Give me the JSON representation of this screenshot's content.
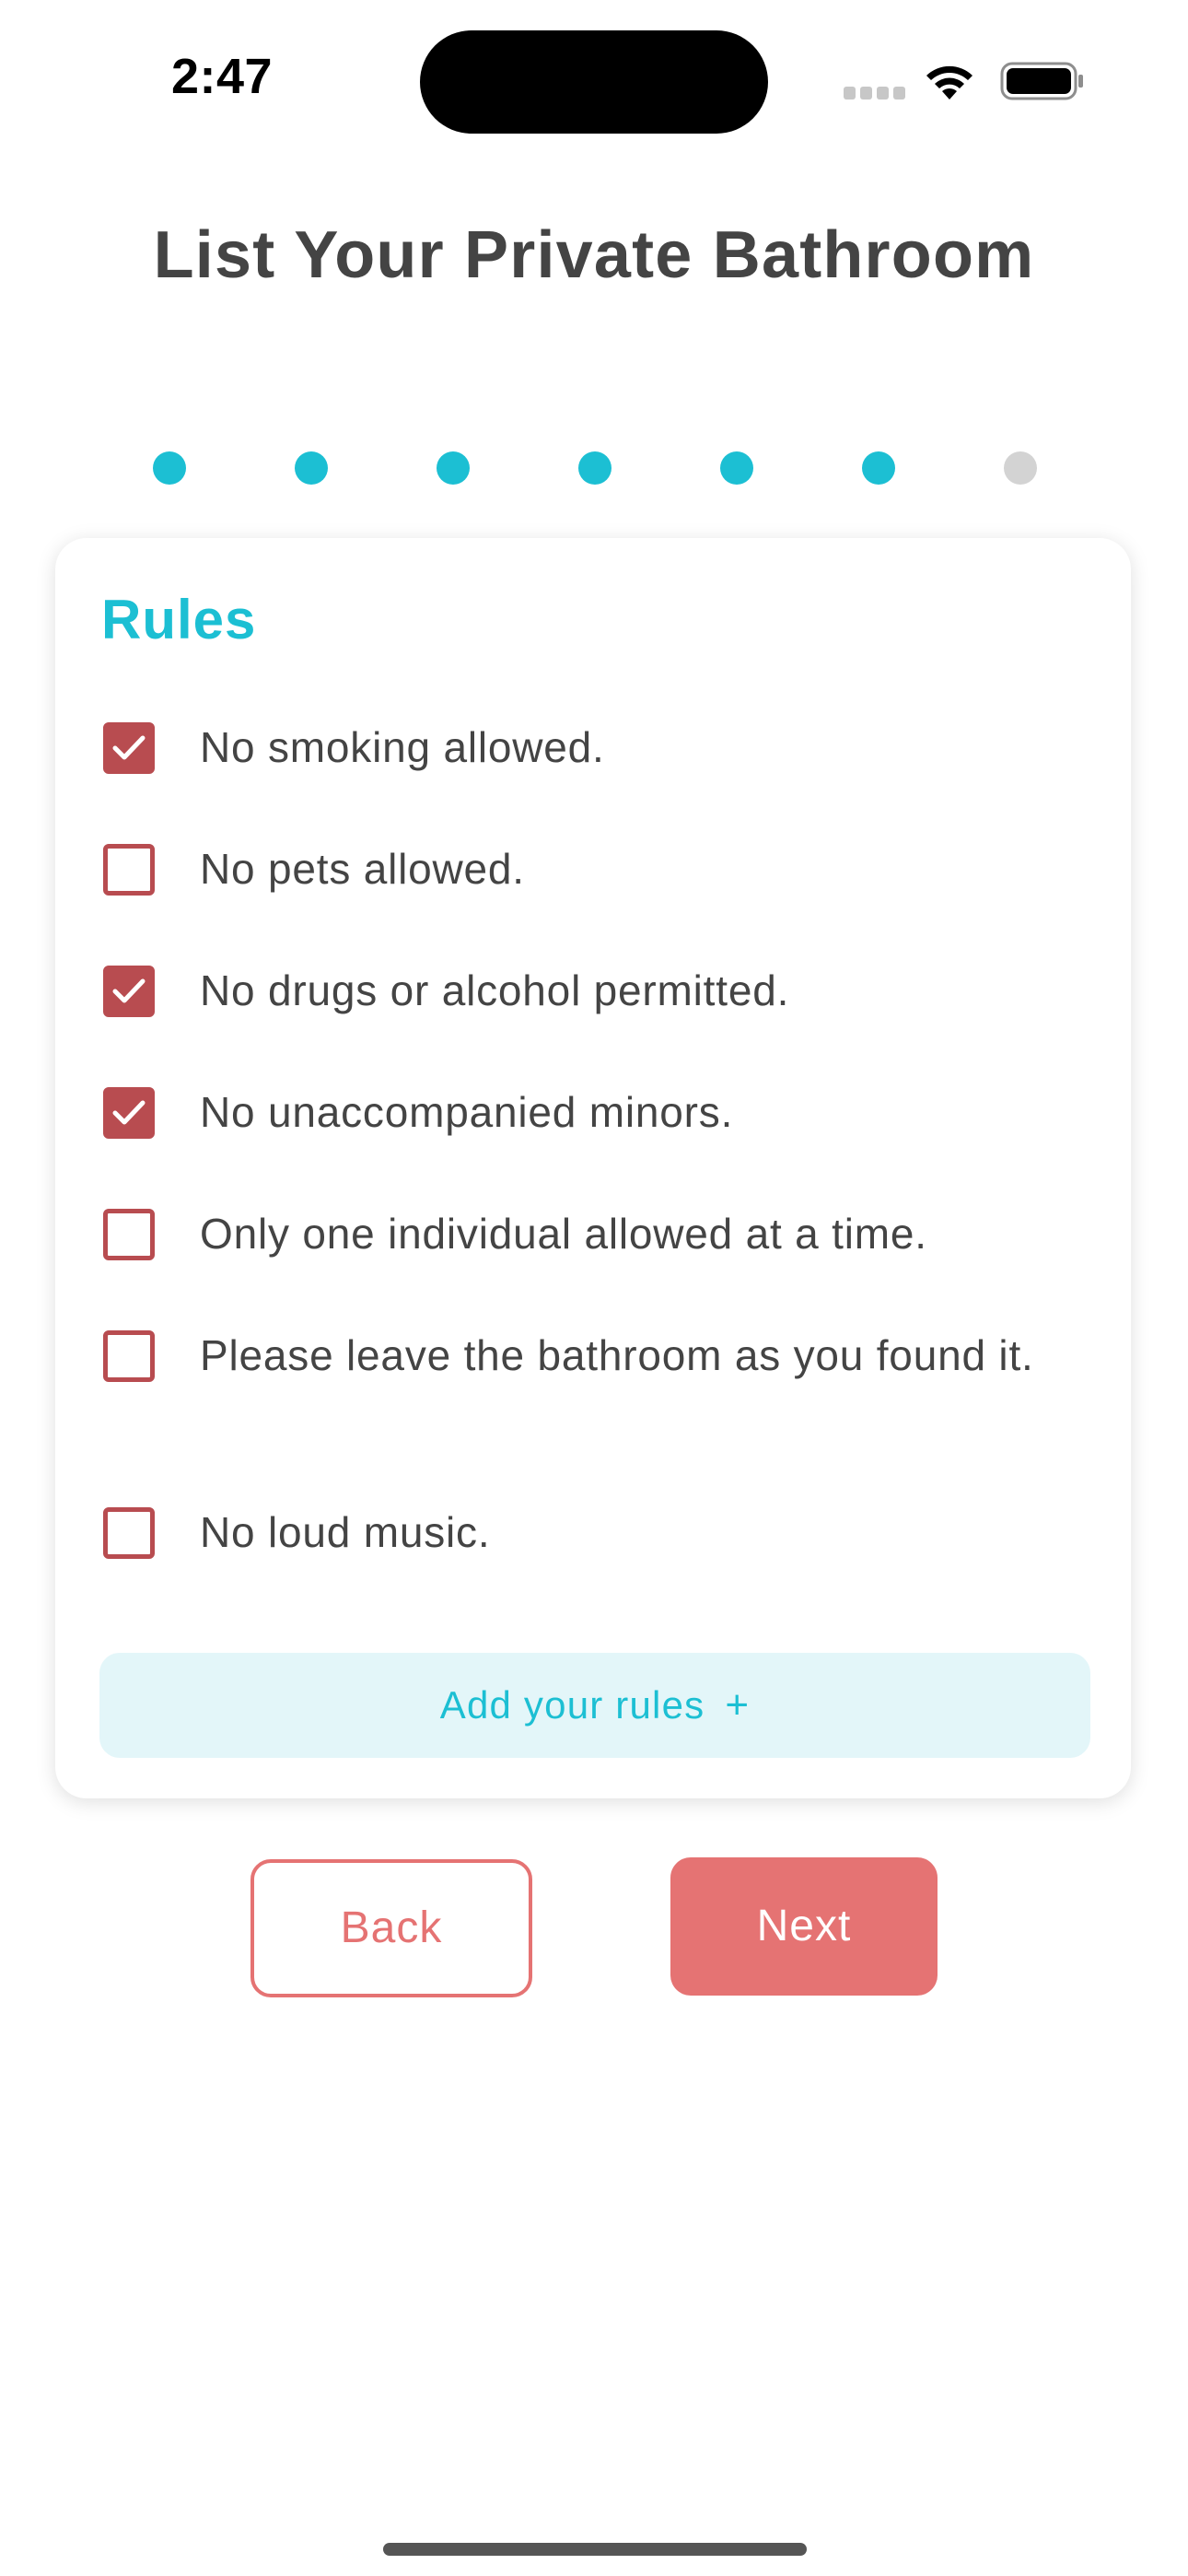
{
  "status_bar": {
    "time": "2:47"
  },
  "header": {
    "title": "List Your Private Bathroom"
  },
  "progress": {
    "total_steps": 7,
    "completed_steps": 6,
    "active_color": "#1cbfd3",
    "inactive_color": "#d3d3d3"
  },
  "rules_card": {
    "title": "Rules",
    "items": [
      {
        "label": "No smoking allowed.",
        "checked": true
      },
      {
        "label": "No pets allowed.",
        "checked": false
      },
      {
        "label": "No drugs or alcohol permitted.",
        "checked": true
      },
      {
        "label": "No unaccompanied minors.",
        "checked": true
      },
      {
        "label": "Only one individual allowed at a time.",
        "checked": false
      },
      {
        "label": "Please leave the bathroom as you found it.",
        "checked": false
      },
      {
        "label": "No loud music.",
        "checked": false
      }
    ],
    "add_button_label": "Add your rules",
    "add_button_icon": "+"
  },
  "actions": {
    "back_label": "Back",
    "next_label": "Next"
  },
  "colors": {
    "accent": "#1cbfd3",
    "checkbox": "#b84c50",
    "button": "#e57373",
    "text": "#444444"
  }
}
